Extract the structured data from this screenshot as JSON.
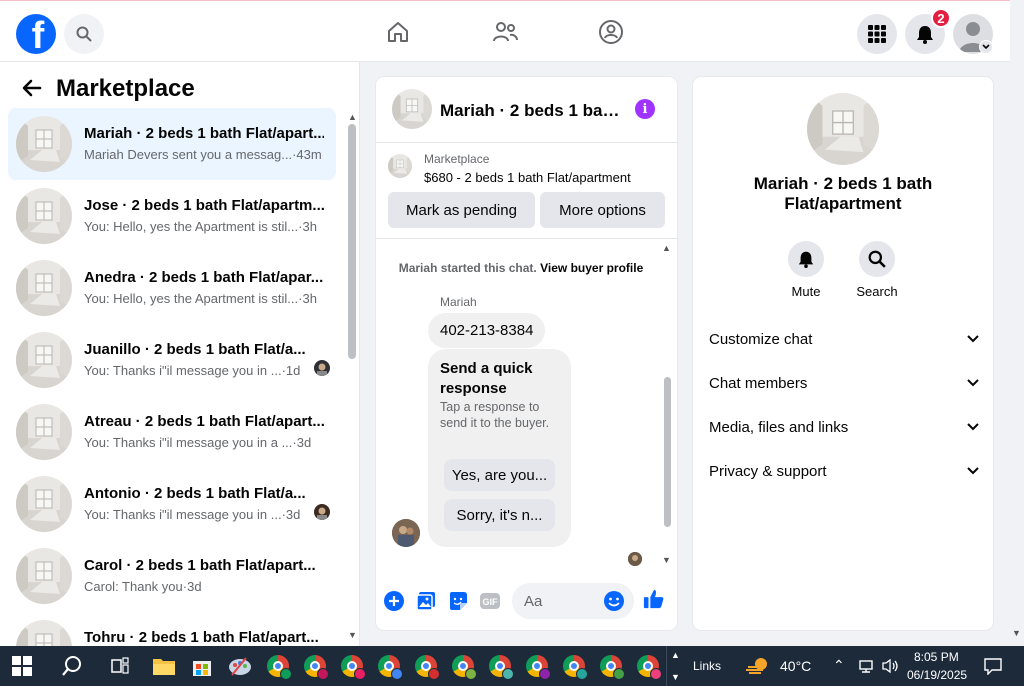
{
  "topbar": {
    "logo_letter": "f",
    "icons": [
      "facebook-logo",
      "search-icon",
      "home-icon",
      "friends-icon",
      "groups-icon",
      "menu-grid-icon",
      "bell-icon",
      "account-avatar"
    ],
    "notification_count": "2"
  },
  "left_panel": {
    "title": "Marketplace",
    "conversations": [
      {
        "title": "Mariah · 2 beds 1 bath Flat/apart...",
        "message": "Mariah Devers sent you a messag...",
        "time": "·43m",
        "active": true
      },
      {
        "title": "Jose · 2 beds 1 bath Flat/apartm...",
        "message": "You: Hello, yes the Apartment is stil...",
        "time": "·3h"
      },
      {
        "title": "Anedra · 2 beds 1 bath Flat/apar...",
        "message": "You: Hello, yes the Apartment is stil...",
        "time": "·3h"
      },
      {
        "title": "Juanillo · 2 beds 1 bath Flat/a...",
        "message": "You: Thanks i\"il message you in ...",
        "time": "·1d"
      },
      {
        "title": "Atreau · 2 beds 1 bath Flat/apart...",
        "message": "You: Thanks i\"il message you in a ...",
        "time": "·3d"
      },
      {
        "title": "Antonio · 2 beds 1 bath Flat/a...",
        "message": "You: Thanks i\"il message you in ...",
        "time": "·3d"
      },
      {
        "title": "Carol · 2 beds 1 bath Flat/apart...",
        "message": "Carol: Thank you",
        "time": "·3d"
      },
      {
        "title": "Tohru · 2 beds 1 bath Flat/apart...",
        "message": "",
        "time": ""
      }
    ]
  },
  "chat": {
    "header_title": "Mariah · 2 beds 1 bat...",
    "listing_category": "Marketplace",
    "listing_price": "$680 - 2 beds 1 bath Flat/apartment",
    "mark_pending_label": "Mark as pending",
    "more_options_label": "More options",
    "started_text": "Mariah started this chat.",
    "buyer_profile_link": "View buyer profile",
    "sender_name": "Mariah",
    "phone_message": "402-213-8384",
    "quick_title": "Send a quick response",
    "quick_desc": "Tap a response to send it to the buyer.",
    "quick_option_1": "Yes, are you...",
    "quick_option_2": "Sorry, it's n...",
    "input_placeholder": "Aa",
    "composer_icons": [
      "plus-icon",
      "photo-icon",
      "sticker-icon",
      "gif-icon",
      "emoji-icon",
      "thumbs-up-icon"
    ]
  },
  "details": {
    "title": "Mariah · 2 beds 1 bath Flat/apartment",
    "mute_label": "Mute",
    "search_label": "Search",
    "sections": [
      "Customize chat",
      "Chat members",
      "Media, files and links",
      "Privacy & support"
    ]
  },
  "taskbar": {
    "links_label": "Links",
    "temperature": "40°C",
    "time": "8:05 PM",
    "date": "06/19/2025"
  },
  "colors": {
    "accent": "#0866ff",
    "info_purple": "#a033ff",
    "badge_red": "#e41e3f",
    "taskbar": "#1c2a3a"
  }
}
